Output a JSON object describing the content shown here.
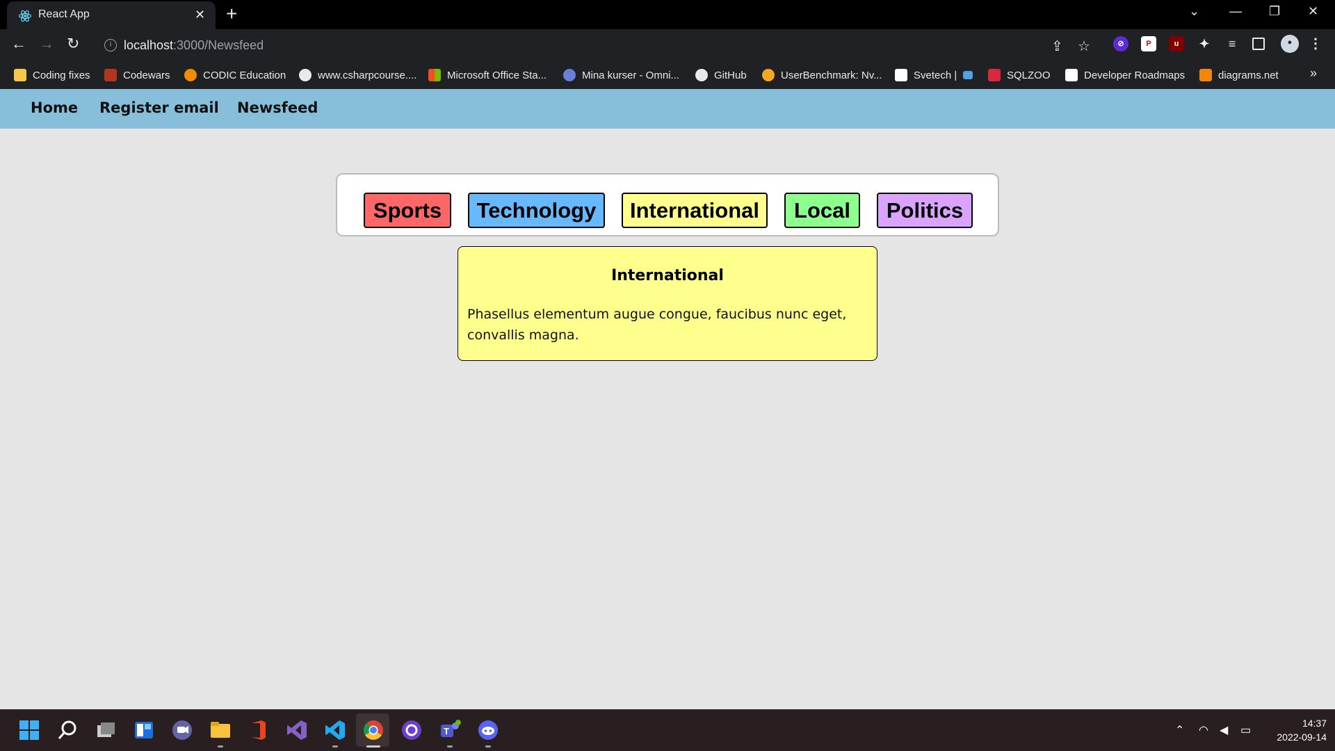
{
  "browser": {
    "tab_title": "React App",
    "url_host": "localhost",
    "url_path": ":3000/Newsfeed",
    "bookmarks": [
      "Coding fixes",
      "Codewars",
      "CODIC Education",
      "www.csharpcourse....",
      "Microsoft Office Sta...",
      "Mina kurser - Omni...",
      "GitHub",
      "UserBenchmark: Nv...",
      "Svetech |",
      "SQLZOO",
      "Developer Roadmaps",
      "diagrams.net"
    ],
    "bookmarks_more": "»"
  },
  "app": {
    "nav": [
      "Home",
      "Register email",
      "Newsfeed"
    ],
    "categories": [
      {
        "label": "Sports",
        "color": "#ff6666"
      },
      {
        "label": "Technology",
        "color": "#66b8ff"
      },
      {
        "label": "International",
        "color": "#ffff8d"
      },
      {
        "label": "Local",
        "color": "#8dff8d"
      },
      {
        "label": "Politics",
        "color": "#d9a3ff"
      }
    ],
    "article": {
      "title": "International",
      "body": "Phasellus elementum augue congue, faucibus nunc eget, convallis magna."
    }
  },
  "taskbar": {
    "time": "14:37",
    "date": "2022-09-14"
  }
}
